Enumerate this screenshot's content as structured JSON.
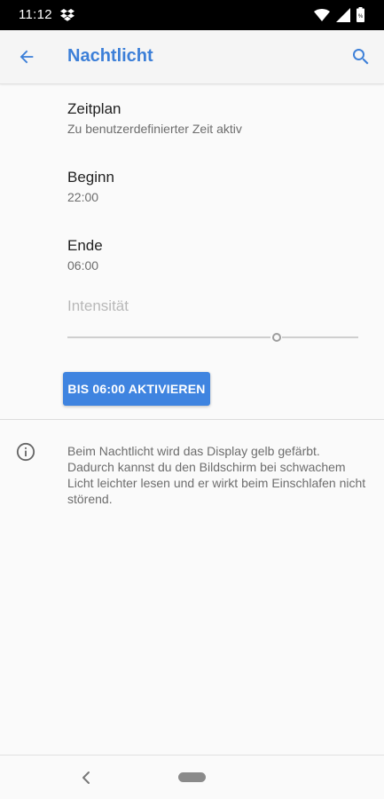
{
  "status_bar": {
    "time": "11:12",
    "icons": [
      "dropbox-icon",
      "wifi-icon",
      "cell-signal-icon",
      "battery-icon"
    ]
  },
  "app_bar": {
    "title": "Nachtlicht",
    "back_icon": "arrow-back-icon",
    "search_icon": "search-icon",
    "accent_color": "#3c7fd8"
  },
  "settings": {
    "schedule": {
      "title": "Zeitplan",
      "summary": "Zu benutzerdefinierter Zeit aktiv"
    },
    "start": {
      "title": "Beginn",
      "value": "22:00"
    },
    "end": {
      "title": "Ende",
      "value": "06:00"
    },
    "intensity": {
      "title": "Intensität",
      "enabled": false,
      "level": 0.72
    }
  },
  "activate_button": {
    "label": "BIS 06:00 AKTIVIEREN",
    "color": "#3f84e0"
  },
  "info": {
    "icon": "info-icon",
    "text": "Beim Nachtlicht wird das Display gelb gefärbt. Dadurch kannst du den Bildschirm bei schwachem Licht leichter lesen und er wirkt beim Einschlafen nicht störend."
  },
  "nav_bar": {
    "back_icon": "nav-back-icon",
    "home_icon": "home-pill-icon"
  }
}
